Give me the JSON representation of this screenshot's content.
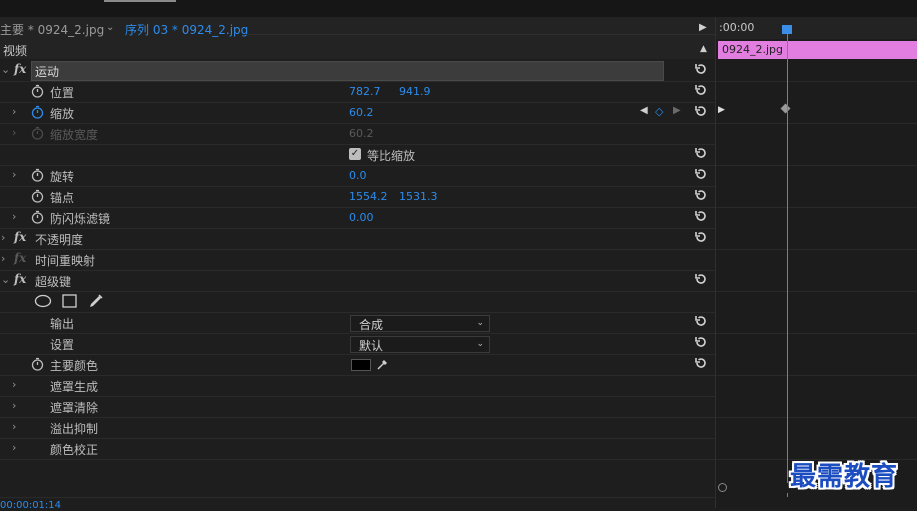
{
  "tabs": {
    "source": "主要 * 0924_2.jpg",
    "sequence": "序列 03 * 0924_2.jpg"
  },
  "section_video": "视频",
  "effects": {
    "motion": {
      "label": "运动",
      "position": {
        "label": "位置",
        "x": "782.7",
        "y": "941.9"
      },
      "scale": {
        "label": "缩放",
        "value": "60.2"
      },
      "scale_width": {
        "label": "缩放宽度",
        "value": "60.2"
      },
      "uniform_scale": {
        "label": "等比缩放",
        "checked": true
      },
      "rotation": {
        "label": "旋转",
        "value": "0.0"
      },
      "anchor": {
        "label": "锚点",
        "x": "1554.2",
        "y": "1531.3"
      },
      "antiflicker": {
        "label": "防闪烁滤镜",
        "value": "0.00"
      }
    },
    "opacity": {
      "label": "不透明度"
    },
    "time_remap": {
      "label": "时间重映射"
    },
    "ultra_key": {
      "label": "超级键",
      "output": {
        "label": "输出",
        "value": "合成"
      },
      "setting": {
        "label": "设置",
        "value": "默认"
      },
      "key_color": {
        "label": "主要颜色",
        "color": "#000000"
      },
      "matte_generation": "遮罩生成",
      "matte_cleanup": "遮罩清除",
      "spill_suppression": "溢出抑制",
      "color_correction": "颜色校正"
    }
  },
  "timeline": {
    "timecode": ":00:00",
    "clip_label": "0924_2.jpg",
    "clip_color": "#e27ee0"
  },
  "bottom_timecode": "00:00:01:14",
  "watermark": "最需教育",
  "colors": {
    "accent": "#2d8ceb",
    "playhead": "#3a8ee6"
  }
}
